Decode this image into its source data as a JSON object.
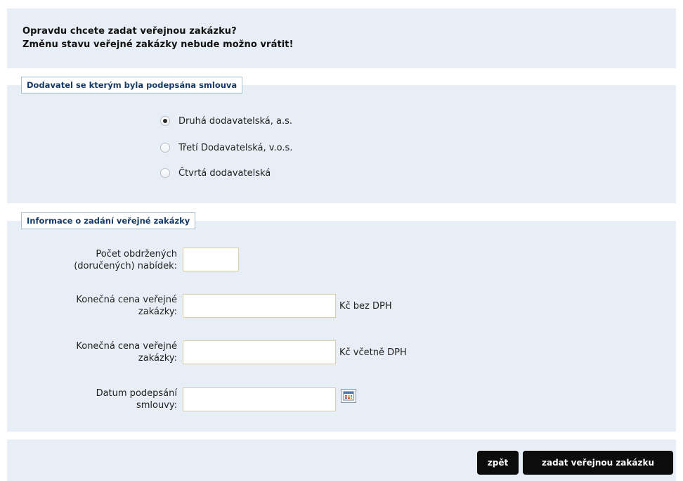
{
  "warning": {
    "line1": "Opravdu chcete zadat veřejnou zakázku?",
    "line2": "Změnu stavu veřejné zakázky nebude možno vrátit!"
  },
  "supplier_section": {
    "legend": "Dodavatel se kterým byla podepsána smlouva",
    "options": [
      {
        "label": "Druhá dodavatelská, a.s.",
        "checked": true
      },
      {
        "label": "Třetí Dodavatelská, v.o.s.",
        "checked": false
      },
      {
        "label": "Čtvrtá dodavatelská",
        "checked": false
      }
    ]
  },
  "info_section": {
    "legend": "Informace o zadání veřejné zakázky",
    "offers": {
      "label_line1": "Počet obdržených",
      "label_line2": "(doručených) nabídek:",
      "value": ""
    },
    "price_excl": {
      "label_line1": "Konečná cena veřejné",
      "label_line2": "zakázky:",
      "value": "",
      "unit": "Kč bez DPH"
    },
    "price_incl": {
      "label_line1": "Konečná cena veřejné",
      "label_line2": "zakázky:",
      "value": "",
      "unit": "Kč včetně DPH"
    },
    "signed_date": {
      "label_line1": "Datum podepsání",
      "label_line2": "smlouvy:",
      "value": "",
      "icon": "calendar-icon"
    }
  },
  "buttons": {
    "back": "zpět",
    "submit": "zadat veřejnou zakázku"
  },
  "colors": {
    "panel_bg": "#e8eef5",
    "legend_text": "#163a66",
    "legend_border": "#a9bfd2",
    "field_border": "#d8cfa4",
    "button_bg": "#0c0c0c"
  }
}
